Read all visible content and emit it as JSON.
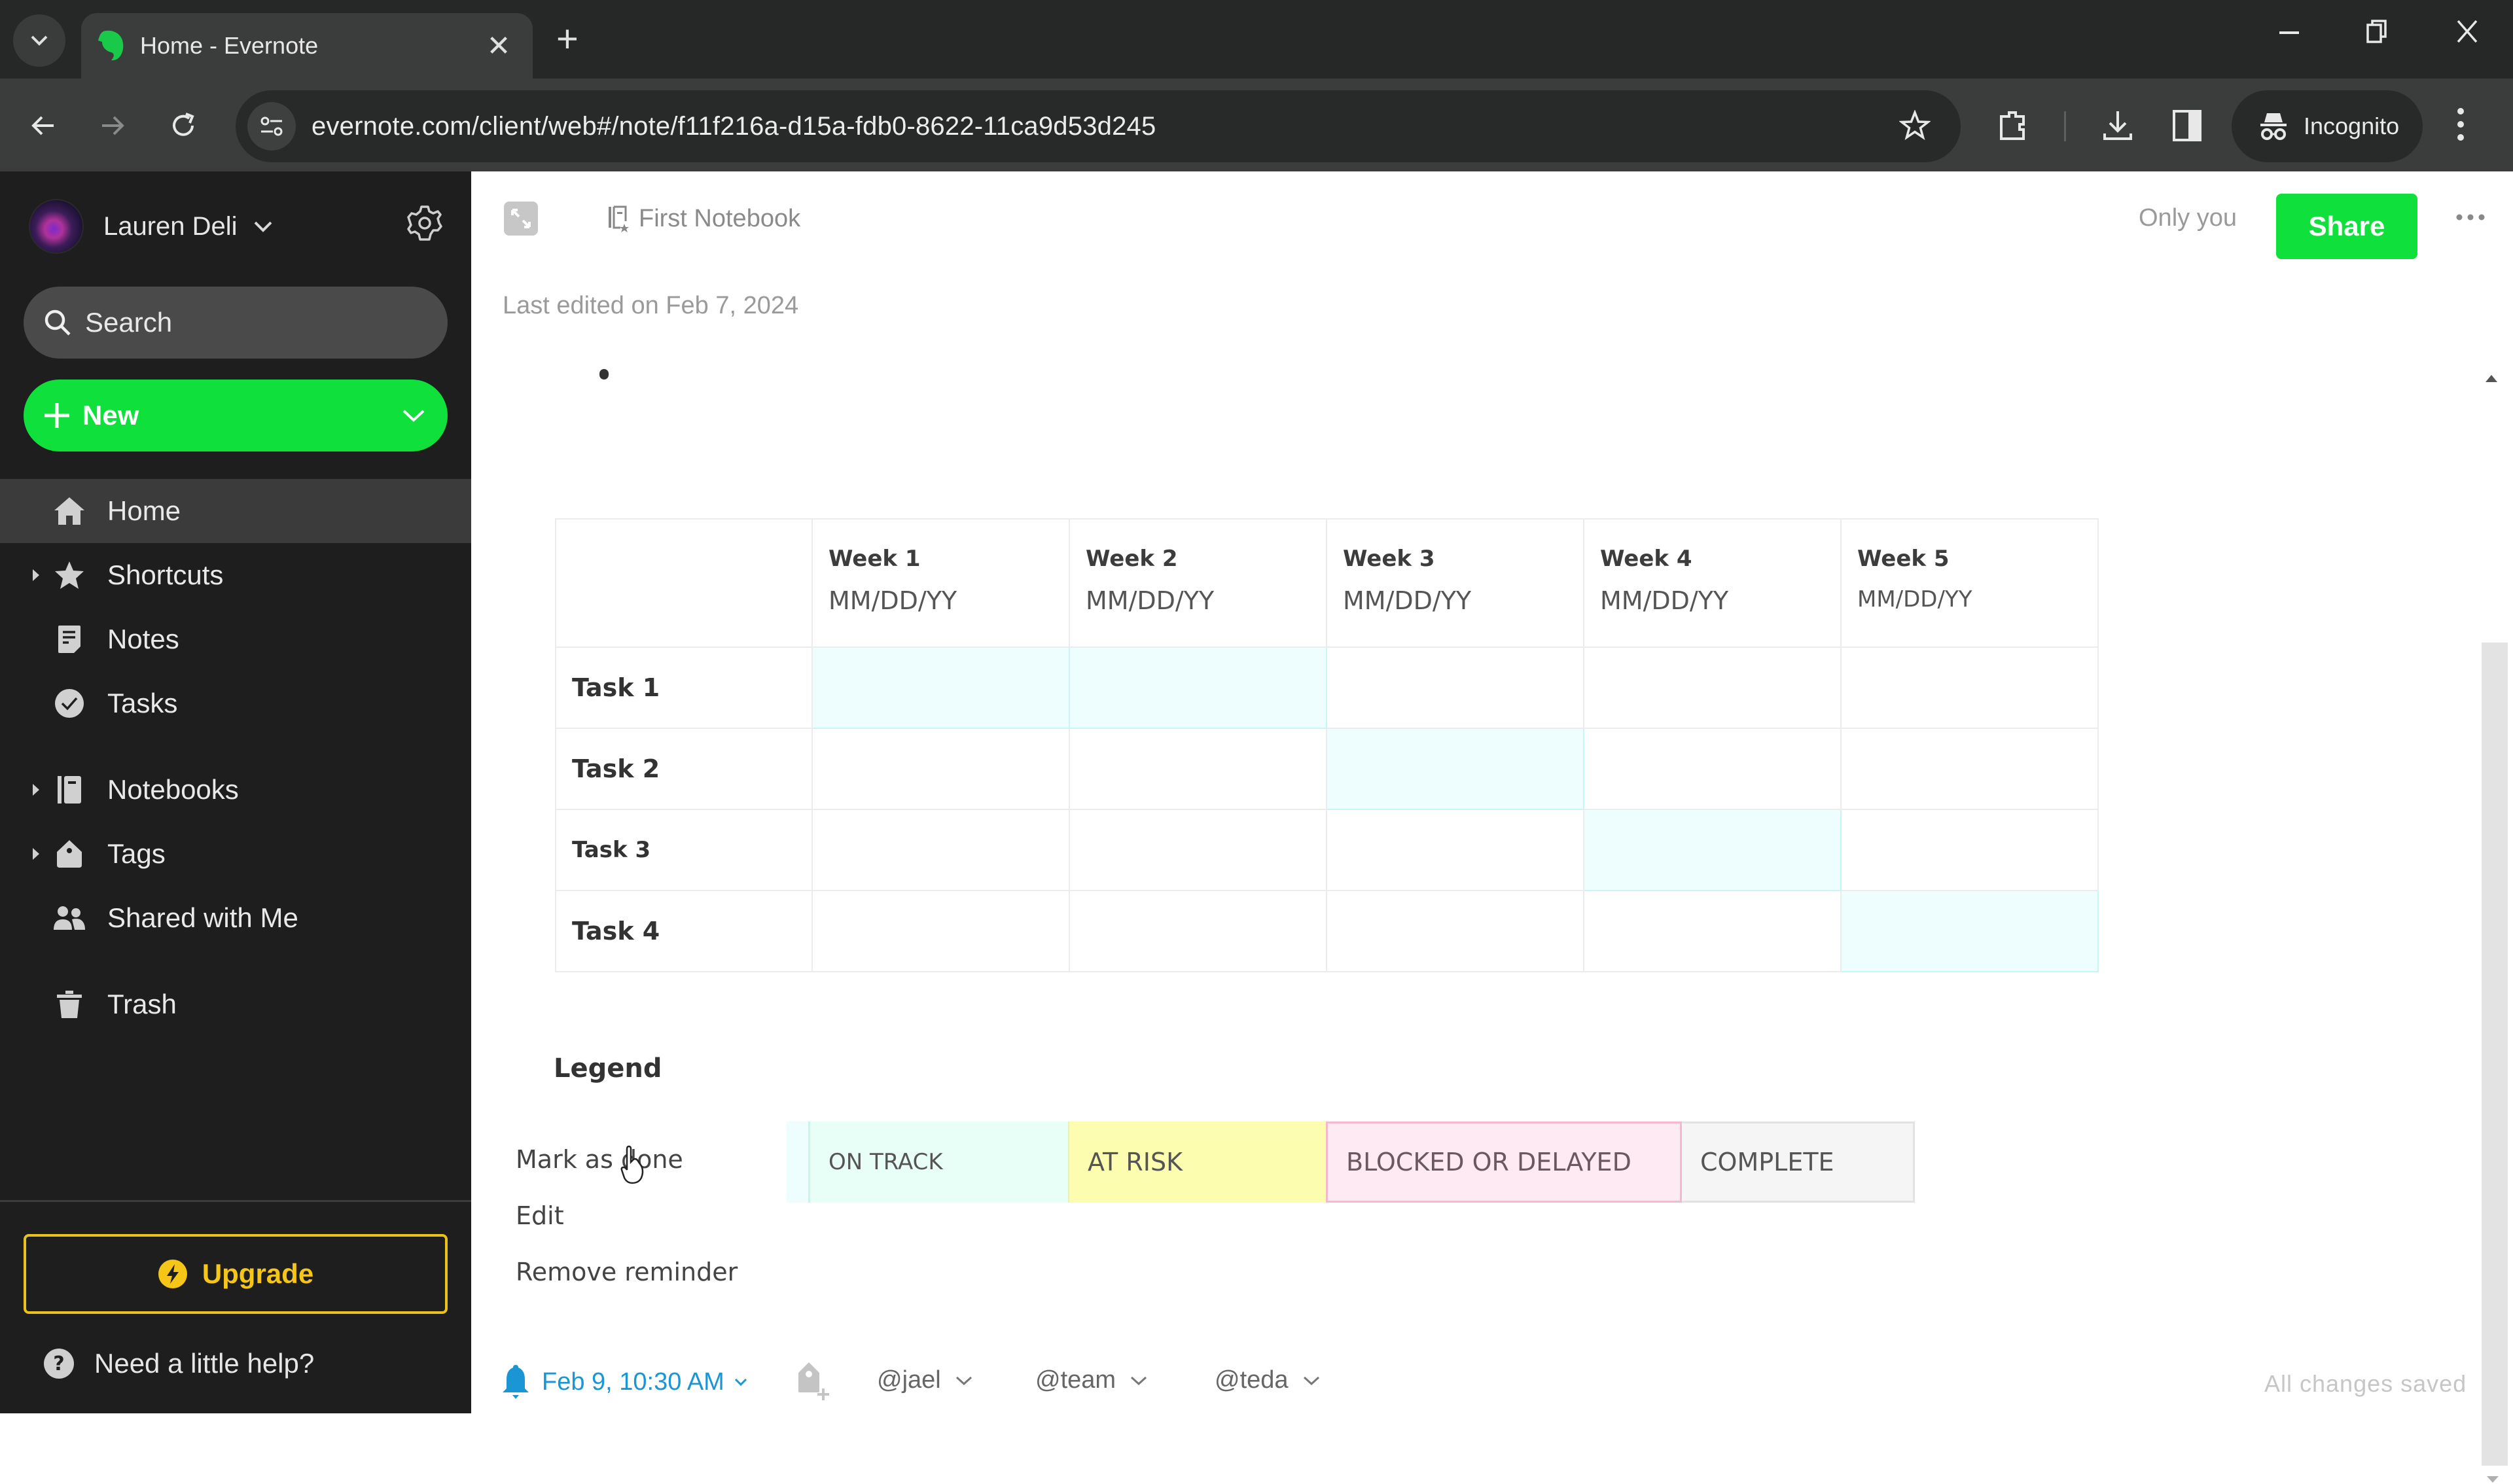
{
  "browser": {
    "tab_title": "Home - Evernote",
    "url": "evernote.com/client/web#/note/f11f216a-d15a-fdb0-8622-11ca9d53d245",
    "incognito_label": "Incognito"
  },
  "sidebar": {
    "user_name": "Lauren Deli",
    "search_placeholder": "Search",
    "new_label": "New",
    "items": [
      {
        "label": "Home",
        "icon": "home-icon",
        "active": true,
        "expandable": false
      },
      {
        "label": "Shortcuts",
        "icon": "star-icon",
        "active": false,
        "expandable": true
      },
      {
        "label": "Notes",
        "icon": "notes-icon",
        "active": false,
        "expandable": false
      },
      {
        "label": "Tasks",
        "icon": "check-circle-icon",
        "active": false,
        "expandable": false
      },
      {
        "label": "Notebooks",
        "icon": "notebook-icon",
        "active": false,
        "expandable": true
      },
      {
        "label": "Tags",
        "icon": "tag-icon",
        "active": false,
        "expandable": true
      },
      {
        "label": "Shared with Me",
        "icon": "people-icon",
        "active": false,
        "expandable": false
      },
      {
        "label": "Trash",
        "icon": "trash-icon",
        "active": false,
        "expandable": false
      }
    ],
    "upgrade_label": "Upgrade",
    "help_label": "Need a little help?"
  },
  "note": {
    "notebook": "First Notebook",
    "visibility": "Only you",
    "share_label": "Share",
    "last_edited": "Last edited on Feb 7, 2024",
    "table": {
      "columns": [
        {
          "week": "Week 1",
          "date": "MM/DD/YY"
        },
        {
          "week": "Week 2",
          "date": "MM/DD/YY"
        },
        {
          "week": "Week 3",
          "date": "MM/DD/YY"
        },
        {
          "week": "Week 4",
          "date": "MM/DD/YY"
        },
        {
          "week": "Week 5",
          "date": "MM/DD/YY"
        }
      ],
      "rows": [
        {
          "task": "Task 1",
          "highlighted_weeks": [
            1,
            2
          ]
        },
        {
          "task": "Task 2",
          "highlighted_weeks": [
            3
          ]
        },
        {
          "task": "Task 3",
          "highlighted_weeks": [
            4
          ]
        },
        {
          "task": "Task 4",
          "highlighted_weeks": [
            5
          ]
        }
      ]
    },
    "legend": {
      "title": "Legend",
      "items": [
        {
          "label": "ON TRACK",
          "color": "#e8fff8"
        },
        {
          "label": "AT RISK",
          "color": "#fdfdb0"
        },
        {
          "label": "BLOCKED OR DELAYED",
          "color": "#fdeaf3"
        },
        {
          "label": "COMPLETE",
          "color": "#f5f5f5"
        }
      ]
    },
    "context_menu": [
      "Mark as done",
      "Edit",
      "Remove reminder"
    ]
  },
  "footer": {
    "reminder": "Feb 9, 10:30 AM",
    "mentions": [
      "@jael",
      "@team",
      "@teda"
    ],
    "save_status": "All changes saved"
  },
  "colors": {
    "brand_green": "#10e03c",
    "upgrade_yellow": "#f5c518",
    "reminder_blue": "#1a96d4",
    "highlight_cyan": "#eefefe"
  }
}
